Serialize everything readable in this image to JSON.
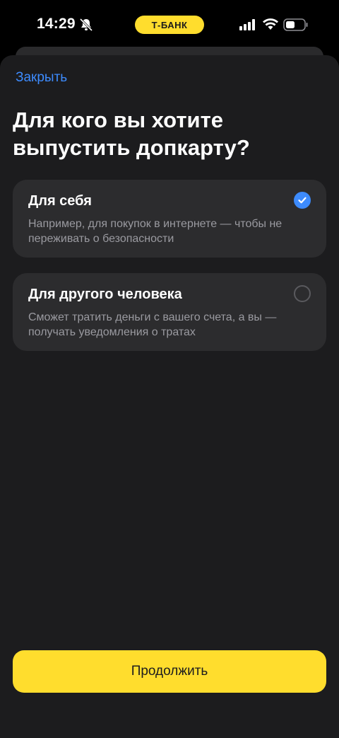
{
  "status_bar": {
    "time": "14:29",
    "brand": "Т-БАНК",
    "icons": [
      "bell-slash-icon",
      "cellular-signal-icon",
      "wifi-icon",
      "battery-icon"
    ]
  },
  "header": {
    "close_label": "Закрыть",
    "title": "Для кого вы хотите выпустить допкарту?"
  },
  "options": [
    {
      "title": "Для себя",
      "description": "Например, для покупок в интернете — чтобы не переживать о безопасности",
      "selected": true
    },
    {
      "title": "Для другого человека",
      "description": "Сможет тратить деньги с вашего счета, а вы — получать уведомления о тратах",
      "selected": false
    }
  ],
  "footer": {
    "continue_label": "Продолжить"
  },
  "colors": {
    "accent": "#3D8BFD",
    "brand_yellow": "#FFDD2D",
    "background": "#1c1c1e",
    "card": "#2c2c2e"
  }
}
